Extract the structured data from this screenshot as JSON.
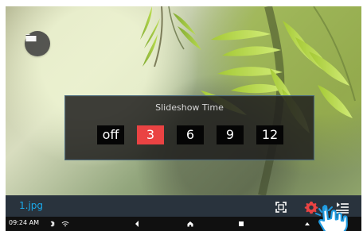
{
  "overlay": {
    "title": "Slideshow Time",
    "options": [
      {
        "label": "off",
        "selected": false
      },
      {
        "label": "3",
        "selected": true
      },
      {
        "label": "6",
        "selected": false
      },
      {
        "label": "9",
        "selected": false
      },
      {
        "label": "12",
        "selected": false
      }
    ]
  },
  "media_bar": {
    "filename": "1.jpg"
  },
  "system_bar": {
    "time": "09:24 AM"
  },
  "icons": {
    "folder": "folder-icon",
    "fit": "fit-screen-icon",
    "settings": "settings-icon",
    "playlist": "playlist-icon",
    "bluetooth": "bluetooth-icon",
    "wifi": "wifi-icon",
    "back": "back-icon",
    "home": "home-icon",
    "recent": "recent-apps-icon",
    "up": "up-icon",
    "cursor": "hand-cursor-icon"
  },
  "colors": {
    "selected_option": "#ea4343",
    "filename": "#1ba8e8",
    "settings": "#ea4343"
  }
}
